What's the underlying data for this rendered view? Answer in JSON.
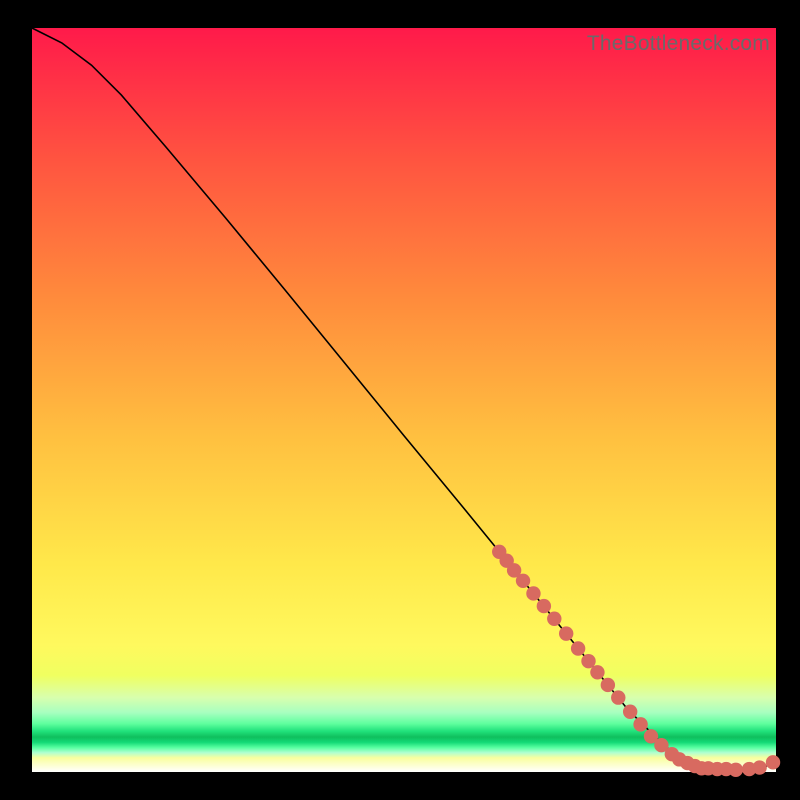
{
  "watermark": "TheBottleneck.com",
  "colors": {
    "marker": "#d86a60",
    "curve": "#000000"
  },
  "chart_data": {
    "type": "line",
    "title": "",
    "xlabel": "",
    "ylabel": "",
    "xlim": [
      0,
      100
    ],
    "ylim": [
      0,
      100
    ],
    "grid": false,
    "curve": {
      "x": [
        0,
        4,
        8,
        12,
        18,
        26,
        34,
        42,
        50,
        58,
        66,
        74,
        80,
        85,
        88,
        90,
        92,
        94,
        96,
        98,
        100
      ],
      "y": [
        100,
        98,
        95,
        91,
        84,
        74.5,
        64.8,
        55,
        45.2,
        35.5,
        25.7,
        15.9,
        8.5,
        3.5,
        1.4,
        0.6,
        0.3,
        0.2,
        0.2,
        0.4,
        1.5
      ]
    },
    "markers": [
      {
        "x": 62.8,
        "y": 29.6
      },
      {
        "x": 63.8,
        "y": 28.4
      },
      {
        "x": 64.8,
        "y": 27.1
      },
      {
        "x": 66.0,
        "y": 25.7
      },
      {
        "x": 67.4,
        "y": 24.0
      },
      {
        "x": 68.8,
        "y": 22.3
      },
      {
        "x": 70.2,
        "y": 20.6
      },
      {
        "x": 71.8,
        "y": 18.6
      },
      {
        "x": 73.4,
        "y": 16.6
      },
      {
        "x": 74.8,
        "y": 14.9
      },
      {
        "x": 76.0,
        "y": 13.4
      },
      {
        "x": 77.4,
        "y": 11.7
      },
      {
        "x": 78.8,
        "y": 10.0
      },
      {
        "x": 80.4,
        "y": 8.1
      },
      {
        "x": 81.8,
        "y": 6.4
      },
      {
        "x": 83.2,
        "y": 4.8
      },
      {
        "x": 84.6,
        "y": 3.6
      },
      {
        "x": 86.0,
        "y": 2.4
      },
      {
        "x": 87.0,
        "y": 1.7
      },
      {
        "x": 88.1,
        "y": 1.2
      },
      {
        "x": 89.1,
        "y": 0.8
      },
      {
        "x": 90.0,
        "y": 0.5
      },
      {
        "x": 90.9,
        "y": 0.5
      },
      {
        "x": 92.1,
        "y": 0.4
      },
      {
        "x": 93.3,
        "y": 0.4
      },
      {
        "x": 94.6,
        "y": 0.3
      },
      {
        "x": 96.4,
        "y": 0.4
      },
      {
        "x": 97.8,
        "y": 0.6
      },
      {
        "x": 99.6,
        "y": 1.3
      }
    ]
  }
}
